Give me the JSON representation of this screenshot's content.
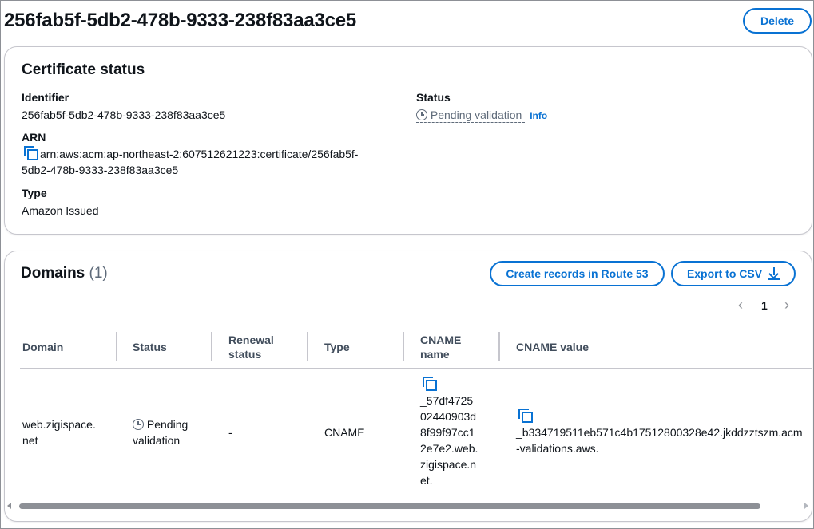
{
  "page": {
    "title": "256fab5f-5db2-478b-9333-238f83aa3ce5",
    "delete_label": "Delete"
  },
  "certificate_status": {
    "heading": "Certificate status",
    "identifier_label": "Identifier",
    "identifier_value": "256fab5f-5db2-478b-9333-238f83aa3ce5",
    "arn_label": "ARN",
    "arn_line1": "arn:aws:acm:ap-northeast-2:607512621223:certificate/256fab5f-",
    "arn_line2": "5db2-478b-9333-238f83aa3ce5",
    "type_label": "Type",
    "type_value": "Amazon Issued",
    "status_label": "Status",
    "status_value": "Pending validation",
    "info_label": "Info"
  },
  "domains": {
    "heading": "Domains",
    "count": "(1)",
    "create_records_label": "Create records in Route 53",
    "export_label": "Export to CSV",
    "page_number": "1",
    "columns": {
      "domain": "Domain",
      "status": "Status",
      "renewal_1": "Renewal",
      "renewal_2": "status",
      "type": "Type",
      "cname_name_1": "CNAME",
      "cname_name_2": "name",
      "cname_value": "CNAME value"
    },
    "row": {
      "domain_1": "web.zigispace.",
      "domain_2": "net",
      "status_1": "Pending",
      "status_2": "validation",
      "renewal": "-",
      "type": "CNAME",
      "cname_name_1": "_57df4725",
      "cname_name_2": "02440903d",
      "cname_name_3": "8f99f97cc1",
      "cname_name_4": "2e7e2.web.",
      "cname_name_5": "zigispace.n",
      "cname_name_6": "et.",
      "cname_value_1": "_b334719511eb571c4b17512800328e42.jkddzztszm.acm",
      "cname_value_2": "-validations.aws."
    }
  },
  "colors": {
    "accent": "#0972d3",
    "muted": "#5f6b7a",
    "border": "#c6c6cd"
  }
}
